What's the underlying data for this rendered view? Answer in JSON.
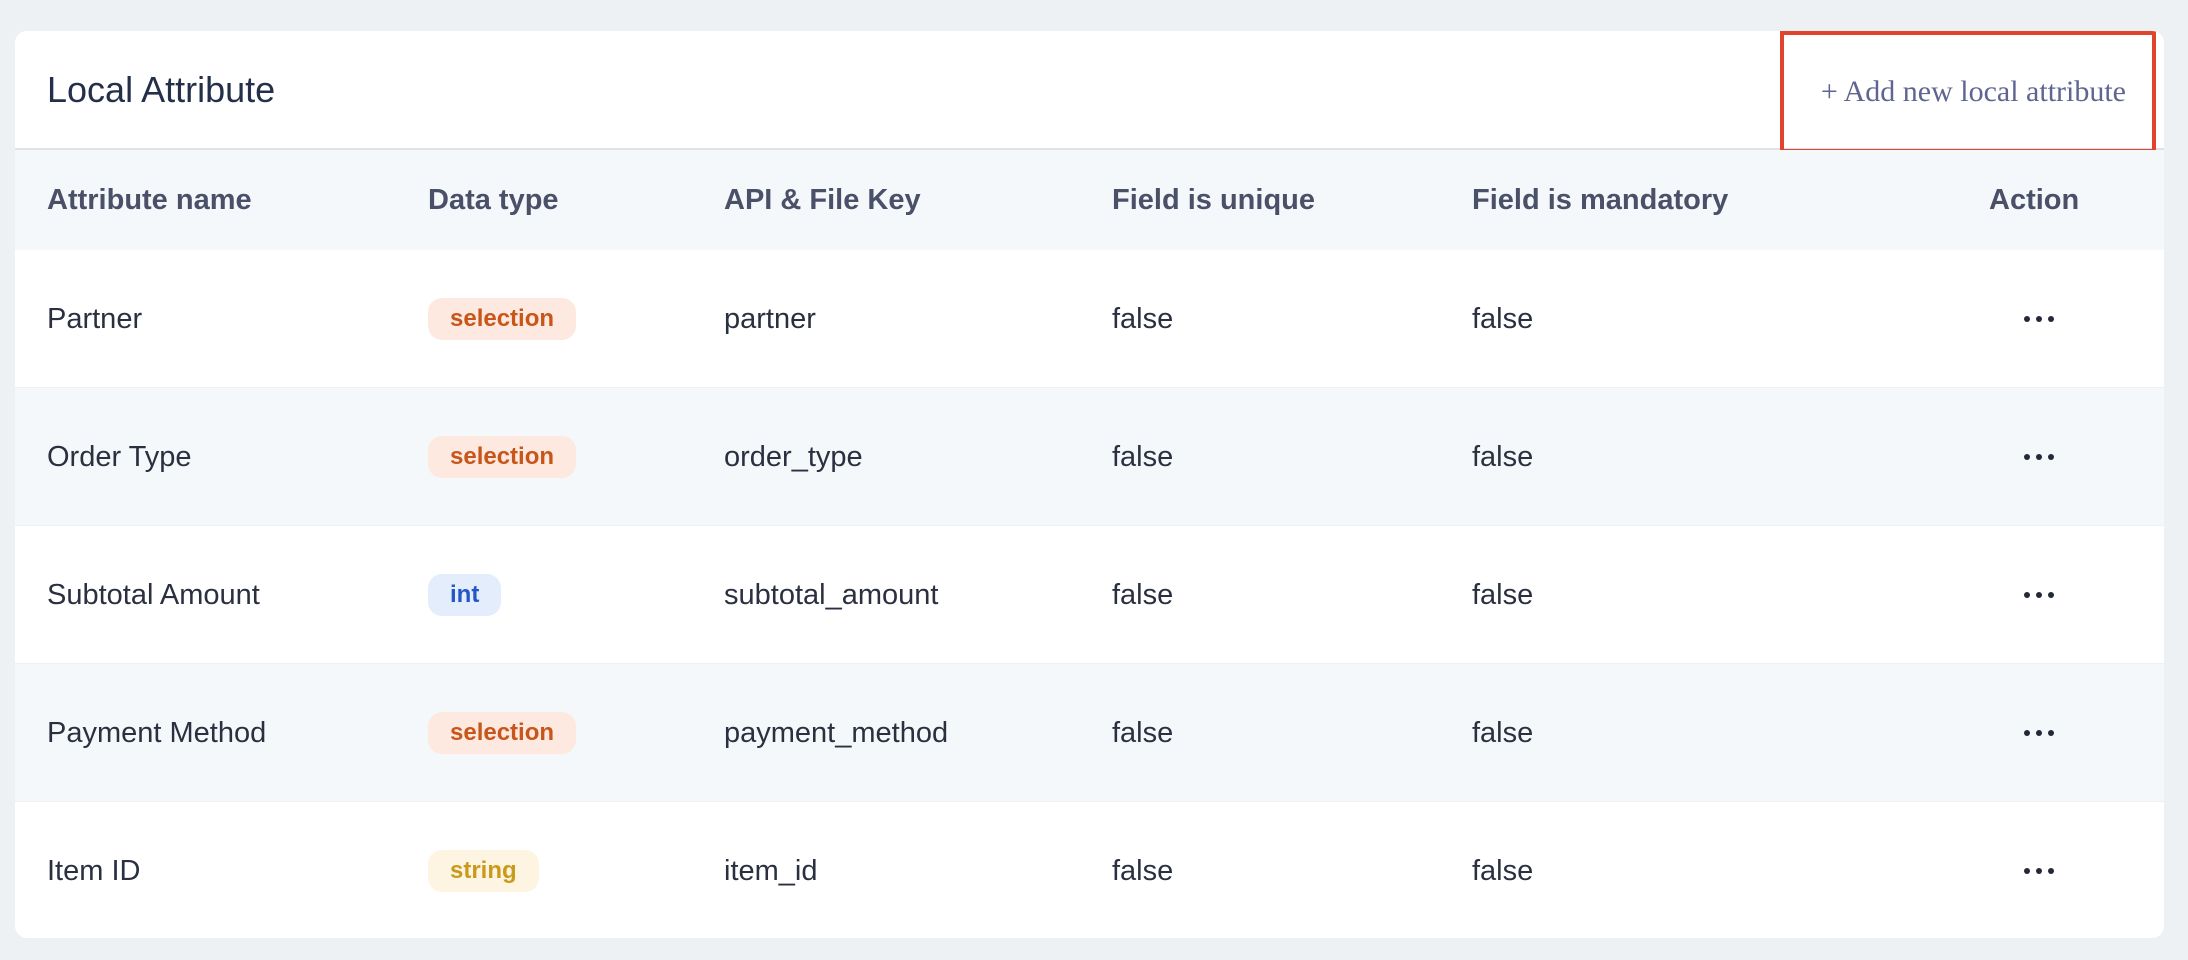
{
  "header": {
    "title": "Local Attribute",
    "add_button_label": "+ Add new local attribute"
  },
  "table": {
    "columns": [
      "Attribute name",
      "Data type",
      "API & File Key",
      "Field is unique",
      "Field is mandatory",
      "Action"
    ],
    "rows": [
      {
        "name": "Partner",
        "data_type": "selection",
        "key": "partner",
        "unique": "false",
        "mandatory": "false",
        "action_icon": "more-horizontal-icon"
      },
      {
        "name": "Order Type",
        "data_type": "selection",
        "key": "order_type",
        "unique": "false",
        "mandatory": "false",
        "action_icon": "more-horizontal-icon"
      },
      {
        "name": "Subtotal Amount",
        "data_type": "int",
        "key": "subtotal_amount",
        "unique": "false",
        "mandatory": "false",
        "action_icon": "more-horizontal-icon"
      },
      {
        "name": "Payment Method",
        "data_type": "selection",
        "key": "payment_method",
        "unique": "false",
        "mandatory": "false",
        "action_icon": "more-horizontal-icon"
      },
      {
        "name": "Item ID",
        "data_type": "string",
        "key": "item_id",
        "unique": "false",
        "mandatory": "false",
        "action_icon": "more-horizontal-icon"
      }
    ]
  },
  "colors": {
    "page_background": "#edf1f4",
    "highlight_border": "#e0442c",
    "badge_selection_bg": "#fde9df",
    "badge_selection_text": "#c8561b",
    "badge_int_bg": "#e3edfb",
    "badge_int_text": "#2357c8",
    "badge_string_bg": "#fdf5e1",
    "badge_string_text": "#c99a1c"
  }
}
